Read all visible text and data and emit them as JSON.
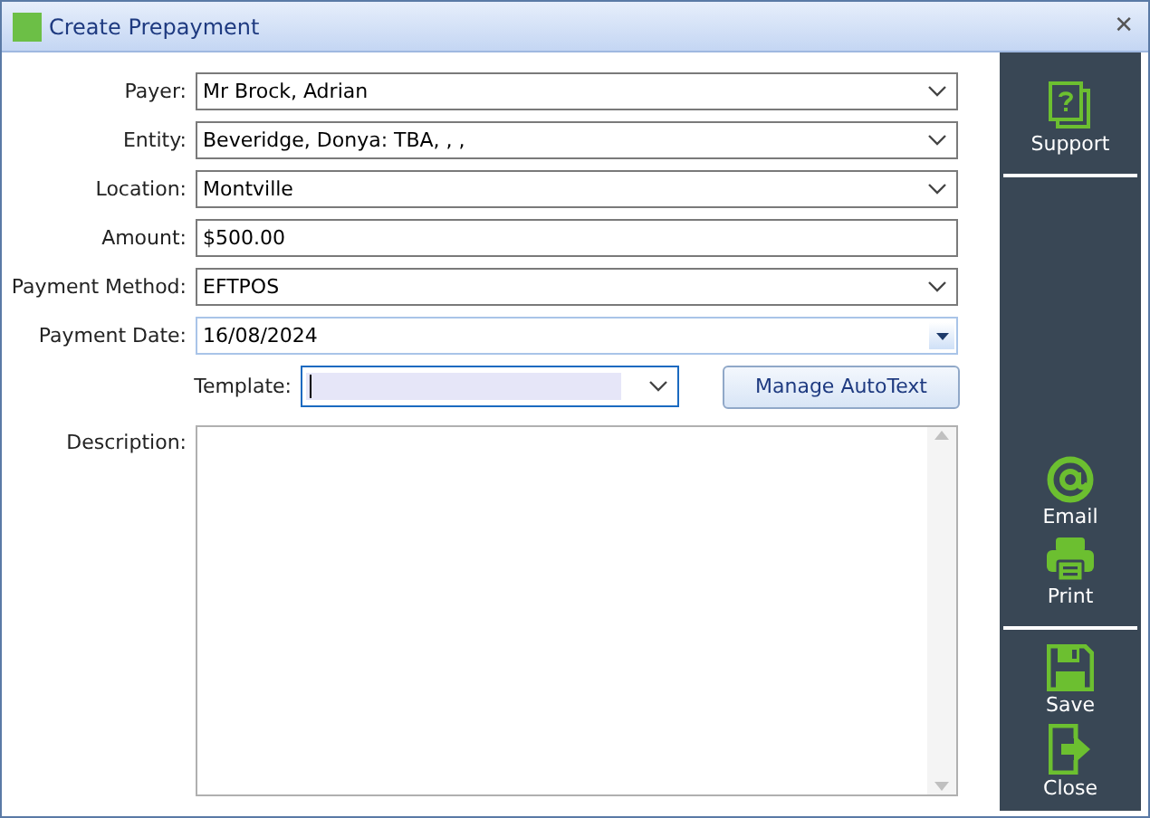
{
  "window": {
    "title": "Create Prepayment",
    "close": "✕"
  },
  "fields": [
    {
      "label": "Payer:",
      "value": "Mr Brock, Adrian",
      "kind": "dropdown"
    },
    {
      "label": "Entity:",
      "value": "Beveridge, Donya: TBA, , ,",
      "kind": "dropdown"
    },
    {
      "label": "Location:",
      "value": "Montville",
      "kind": "dropdown"
    },
    {
      "label": "Amount:",
      "value": "$500.00",
      "kind": "text"
    },
    {
      "label": "Payment Method:",
      "value": "EFTPOS",
      "kind": "dropdown"
    },
    {
      "label": "Payment Date:",
      "value": "16/08/2024",
      "kind": "date"
    }
  ],
  "template": {
    "label": "Template:",
    "button": "Manage AutoText"
  },
  "description": {
    "label": "Description:"
  },
  "sidebar": [
    {
      "label": "Support",
      "kind": "support",
      "divider_after": true
    },
    {
      "label": "Email",
      "kind": "email",
      "divider_after": false
    },
    {
      "label": "Print",
      "kind": "print",
      "divider_after": true
    },
    {
      "label": "Save",
      "kind": "save",
      "divider_after": false
    },
    {
      "label": "Close",
      "kind": "close",
      "divider_after": false
    }
  ]
}
